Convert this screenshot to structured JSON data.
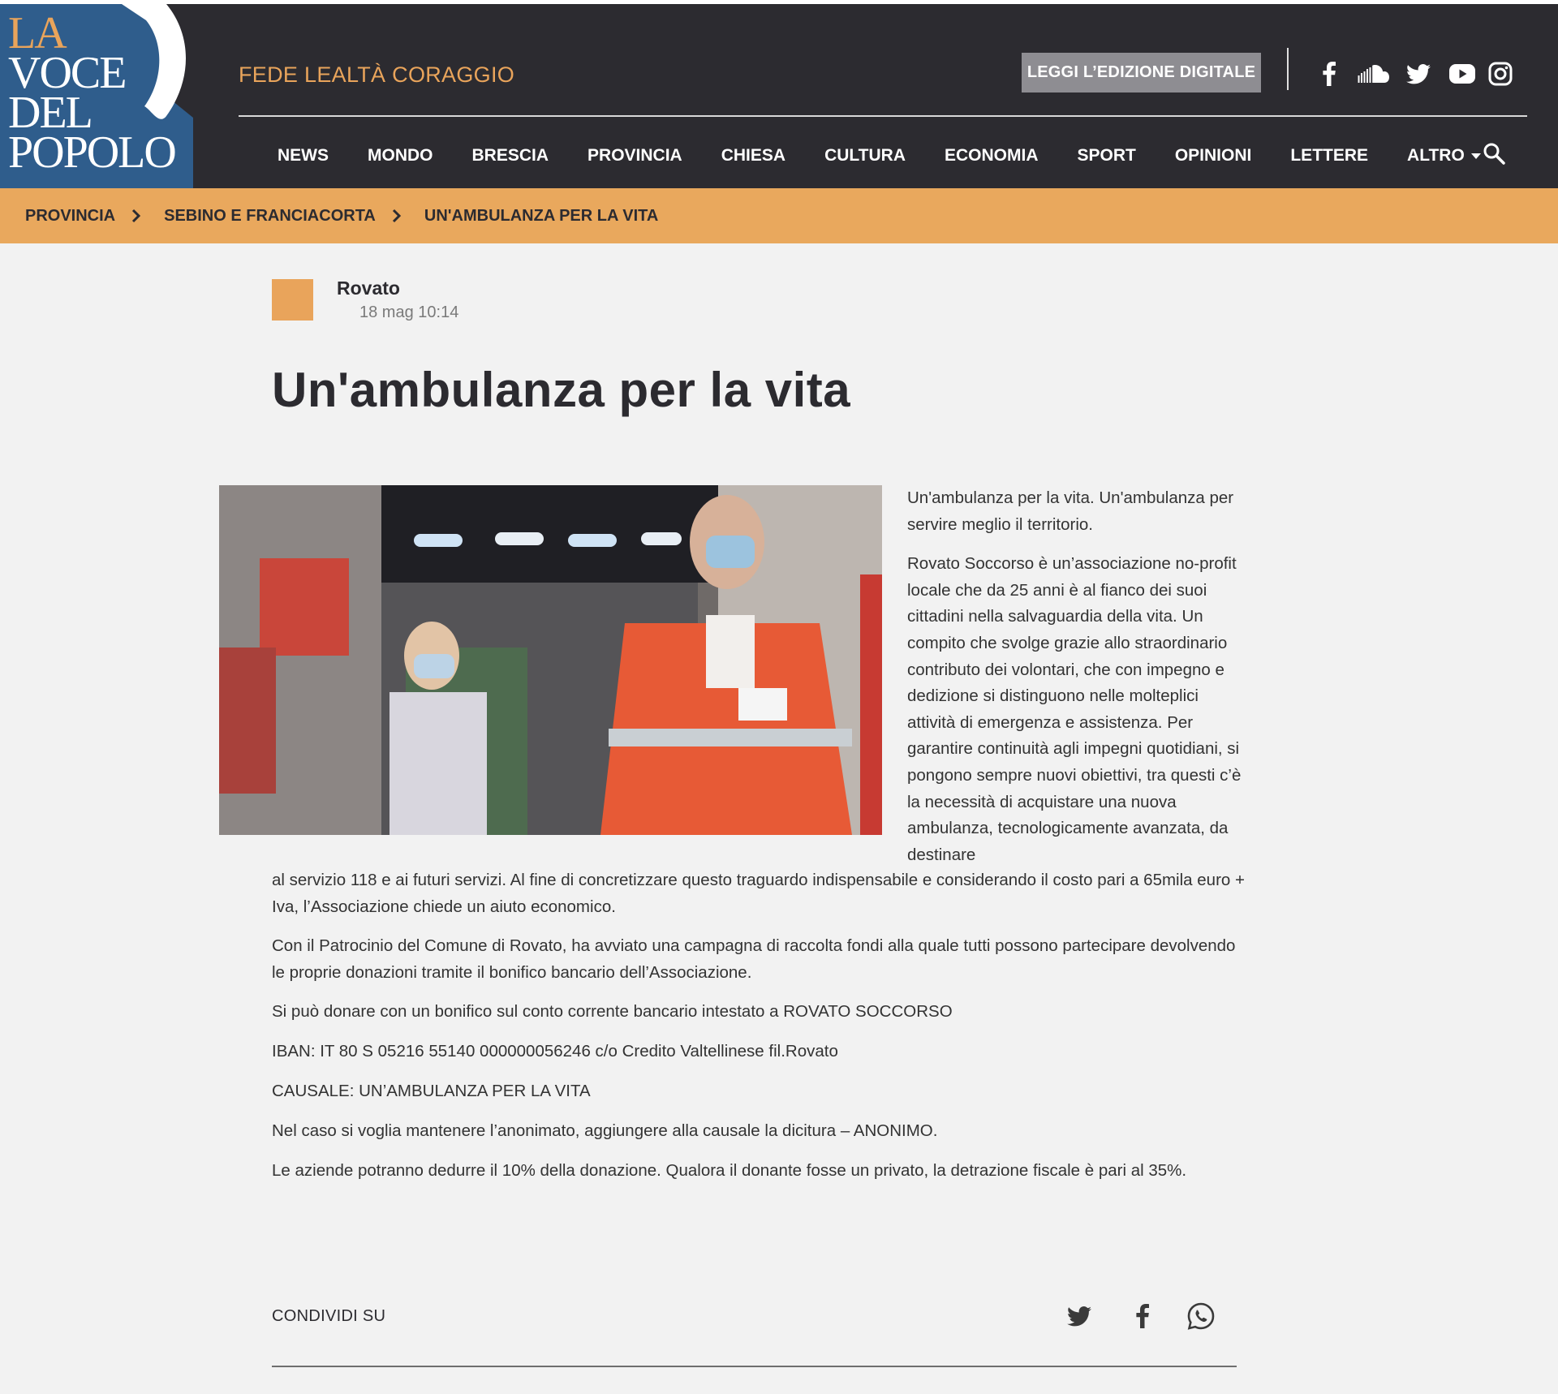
{
  "brand": {
    "logo_line1": "LA",
    "logo_line2": "VOCE",
    "logo_line3": "DEL",
    "logo_line4": "POPOLO",
    "motto": "FEDE LEALTÀ CORAGGIO",
    "accent_color": "#e9a45b",
    "header_bg": "#2c2b30",
    "logo_bg": "#2f5d8c"
  },
  "header": {
    "digital_edition_label": "LEGGI L’EDIZIONE DIGITALE",
    "social_icons": [
      "facebook-icon",
      "soundcloud-icon",
      "twitter-icon",
      "youtube-icon",
      "instagram-icon"
    ]
  },
  "nav": {
    "items": [
      "NEWS",
      "MONDO",
      "BRESCIA",
      "PROVINCIA",
      "CHIESA",
      "CULTURA",
      "ECONOMIA",
      "SPORT",
      "OPINIONI",
      "LETTERE",
      "ALTRO"
    ],
    "search_icon": "search-icon"
  },
  "breadcrumb": {
    "items": [
      "PROVINCIA",
      "SEBINO E FRANCIACORTA",
      "UN'AMBULANZA PER LA VITA"
    ]
  },
  "article": {
    "author": "Rovato",
    "date": "18 mag 10:14",
    "title": "Un'ambulanza per la vita",
    "p1": "Un'ambulanza per la vita. Un'ambulanza per servire meglio il territorio.",
    "p2a": "Rovato Soccorso è un’associazione no-profit locale che da 25 anni è al fianco dei suoi cittadini nella salvaguardia della vita. Un compito che svolge grazie allo straordinario contributo dei volontari, che con impegno e dedizione si distinguono nelle molteplici attività di emergenza e assistenza. Per garantire continuità agli impegni quotidiani, si pongono sempre nuovi obiettivi, tra questi c’è la necessità di acquistare una nuova ambulanza, tecnologicamente avanzata, da destinare",
    "p2b": "al servizio 118 e ai futuri servizi. Al fine di concretizzare questo traguardo indispensabile e considerando il costo pari a 65mila euro + Iva, l’Associazione chiede un aiuto economico.",
    "p3": "Con il Patrocinio del Comune di Rovato, ha avviato una campagna di raccolta fondi alla quale tutti possono partecipare devolvendo le proprie donazioni tramite il bonifico bancario dell’Associazione.",
    "p4": "Si può donare con un bonifico sul conto corrente bancario intestato a ROVATO SOCCORSO",
    "p5": "IBAN: IT 80 S 05216 55140 000000056246 c/o Credito Valtellinese fil.Rovato",
    "p6": "CAUSALE: UN’AMBULANZA PER LA VITA",
    "p7": "Nel caso si voglia mantenere l’anonimato, aggiungere alla causale la dicitura – ANONIMO.",
    "p8": "Le aziende potranno dedurre il 10% della donazione. Qualora il donante fosse un privato, la detrazione fiscale è pari al 35%."
  },
  "share": {
    "label": "CONDIVIDI SU",
    "icons": [
      "twitter-icon",
      "facebook-icon",
      "whatsapp-icon"
    ]
  }
}
